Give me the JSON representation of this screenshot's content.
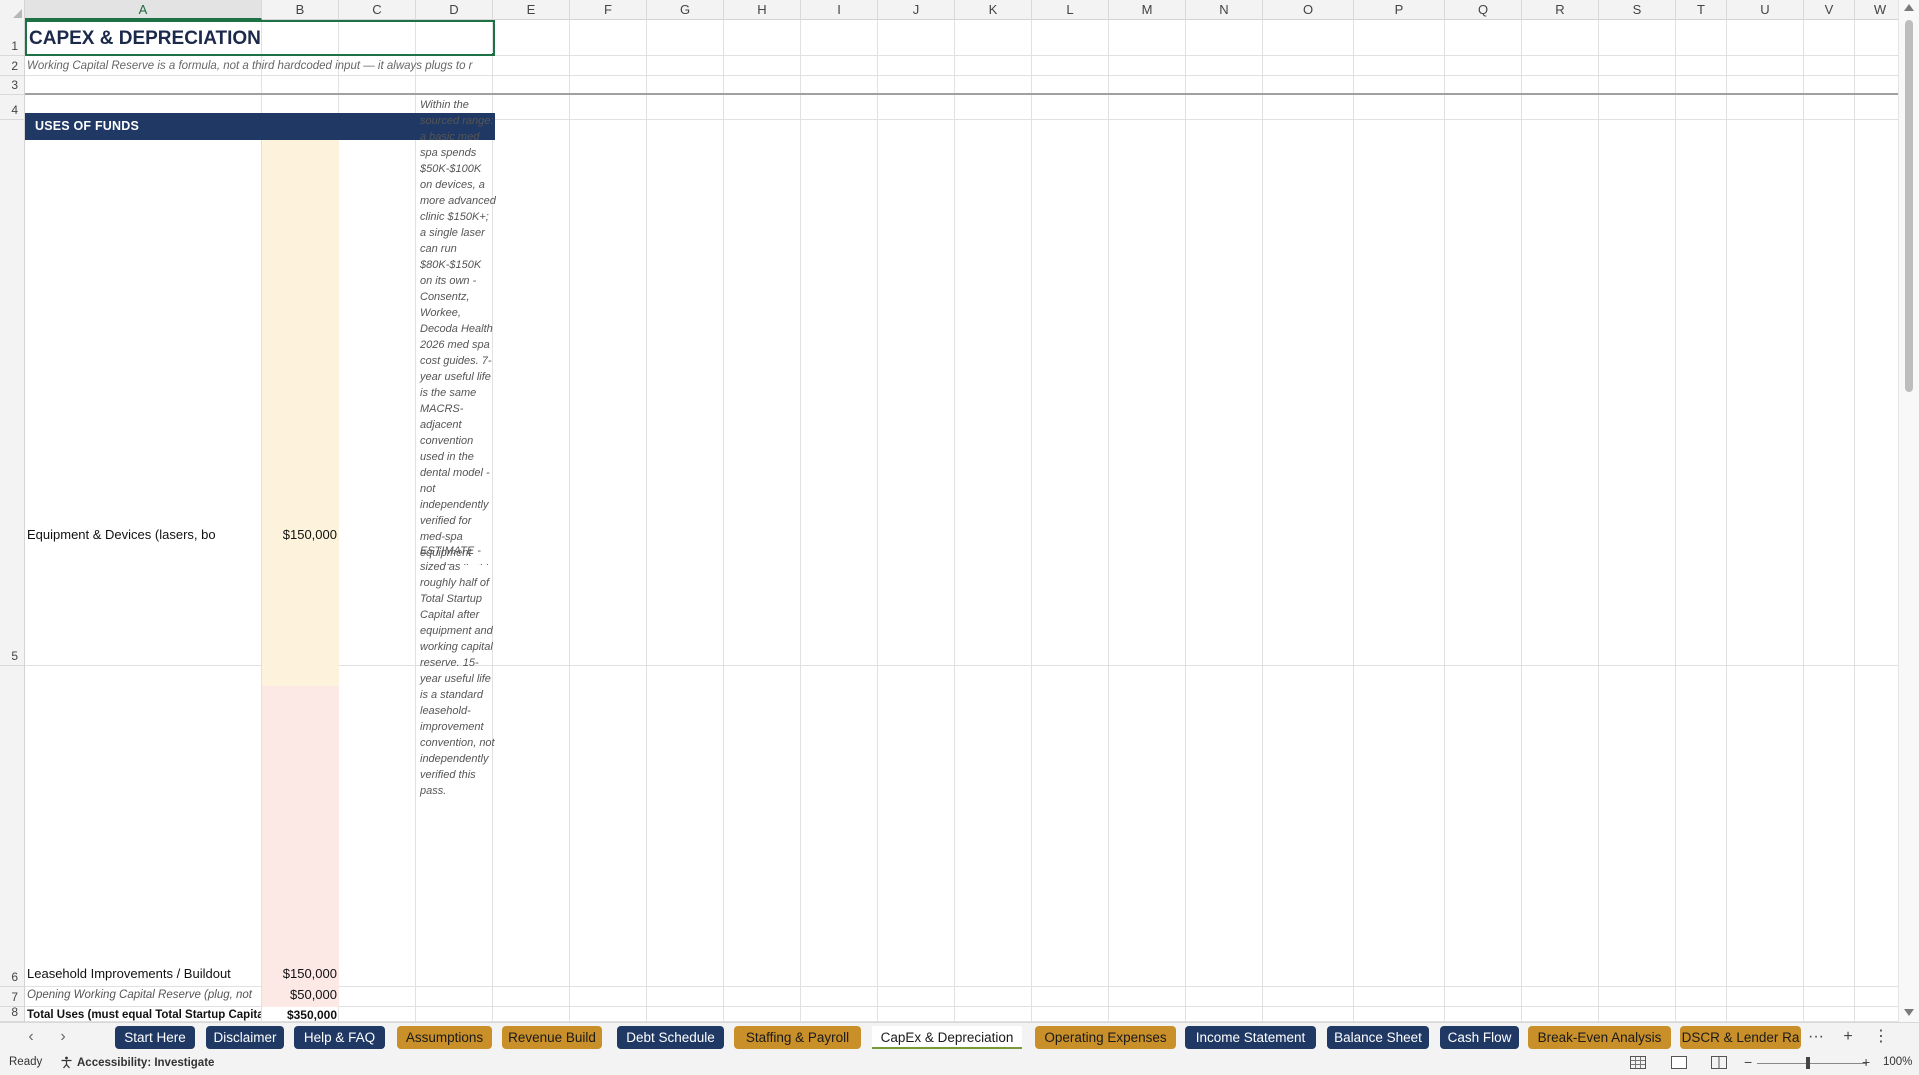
{
  "columns": [
    "A",
    "B",
    "C",
    "D",
    "E",
    "F",
    "G",
    "H",
    "I",
    "J",
    "K",
    "L",
    "M",
    "N",
    "O",
    "P",
    "Q",
    "R",
    "S",
    "T",
    "U",
    "V",
    "W"
  ],
  "rows": [
    "1",
    "2",
    "3",
    "4",
    "5",
    "6",
    "7",
    "8"
  ],
  "sheet": {
    "title": "CAPEX & DEPRECIATION",
    "subtitle": "Working Capital Reserve is a formula, not a third hardcoded input — it always plugs to r",
    "section_header": "USES OF FUNDS",
    "rows": [
      {
        "label": "Equipment & Devices (lasers, body-cor",
        "value": "$150,000",
        "note": "Within the sourced range: a basic med spa spends $50K-$100K on devices, a more advanced clinic $150K+; a single laser can run $80K-$150K on its own - Consentz, Workee, Decoda Health 2026 med spa cost guides. 7-year useful life is the same MACRS-adjacent convention used in the dental model - not independently verified for med-spa equipment specifically this pass."
      },
      {
        "label": "Leasehold Improvements / Buildout",
        "value": "$150,000",
        "note": "ESTIMATE - sized as roughly half of Total Startup Capital after equipment and working capital reserve. 15-year useful life is a standard leasehold-improvement convention, not independently verified this pass."
      },
      {
        "label": "Opening Working Capital Reserve (plug, not",
        "value": "$50,000"
      },
      {
        "label": "Total Uses (must equal Total Startup Capita",
        "value": "$350,000"
      }
    ]
  },
  "tabs": [
    {
      "label": "Start Here",
      "style": "navy"
    },
    {
      "label": "Disclaimer",
      "style": "navy"
    },
    {
      "label": "Help & FAQ",
      "style": "navy"
    },
    {
      "label": "Assumptions",
      "style": "gold"
    },
    {
      "label": "Revenue Build",
      "style": "gold"
    },
    {
      "label": "Debt Schedule",
      "style": "navy"
    },
    {
      "label": "Staffing & Payroll",
      "style": "gold"
    },
    {
      "label": "CapEx & Depreciation",
      "style": "active"
    },
    {
      "label": "Operating Expenses",
      "style": "gold"
    },
    {
      "label": "Income Statement",
      "style": "navy"
    },
    {
      "label": "Balance Sheet",
      "style": "navy"
    },
    {
      "label": "Cash Flow",
      "style": "navy"
    },
    {
      "label": "Break-Even Analysis",
      "style": "gold"
    },
    {
      "label": "DSCR & Lender Ra",
      "style": "gold"
    }
  ],
  "tab_controls": {
    "more": "···",
    "add": "+",
    "options": "⋮"
  },
  "status": {
    "ready": "Ready",
    "accessibility": "Accessibility: Investigate",
    "zoom": "100%"
  },
  "colors": {
    "navy": "#1f3864",
    "gold": "#c9902a",
    "input_yellow": "#fdf3dc",
    "input_pink": "#fce9e6",
    "selection_green": "#1e7145"
  }
}
